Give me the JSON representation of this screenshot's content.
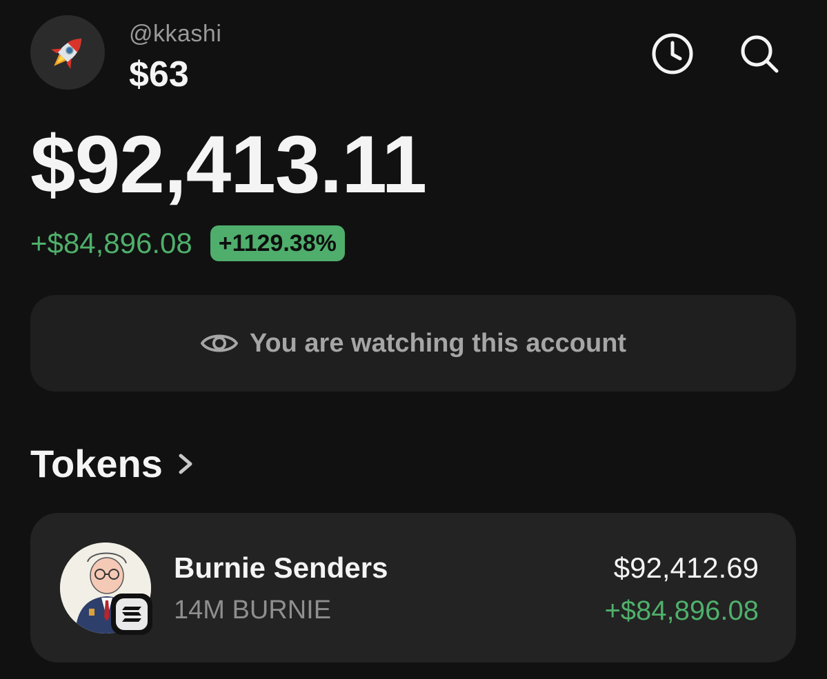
{
  "profile": {
    "username": "@kkashi",
    "small_balance": "$63",
    "avatar_icon": "rocket-icon"
  },
  "header_actions": {
    "history_icon": "clock-icon",
    "search_icon": "search-icon"
  },
  "portfolio": {
    "total_balance": "$92,413.11",
    "change_amount": "+$84,896.08",
    "change_percent": "+1129.38%"
  },
  "watch_banner": {
    "icon": "eye-icon",
    "text": "You are watching this account"
  },
  "tokens_section": {
    "title": "Tokens",
    "chevron_icon": "chevron-right-icon"
  },
  "tokens": [
    {
      "name": "Burnie Senders",
      "amount": "14M BURNIE",
      "value": "$92,412.69",
      "change": "+$84,896.08",
      "chain_icon": "solana-icon"
    }
  ],
  "colors": {
    "background": "#111111",
    "card": "#232323",
    "positive": "#4fb06b",
    "badge": "#4fae6c"
  }
}
